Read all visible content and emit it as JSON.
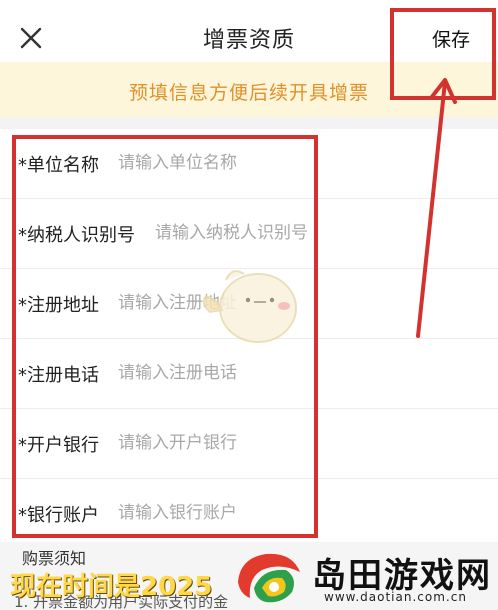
{
  "header": {
    "title": "增票资质",
    "save_label": "保存"
  },
  "notice": {
    "text": "预填信息方便后续开具增票"
  },
  "form": {
    "fields": [
      {
        "label": "*单位名称",
        "placeholder": "请输入单位名称",
        "value": ""
      },
      {
        "label": "*纳税人识别号",
        "placeholder": "请输入纳税人识别号",
        "value": ""
      },
      {
        "label": "*注册地址",
        "placeholder": "请输入注册地址",
        "value": ""
      },
      {
        "label": "*注册电话",
        "placeholder": "请输入注册电话",
        "value": ""
      },
      {
        "label": "*开户银行",
        "placeholder": "请输入开户银行",
        "value": ""
      },
      {
        "label": "*银行账户",
        "placeholder": "请输入银行账户",
        "value": ""
      }
    ]
  },
  "footer": {
    "title": "购票须知",
    "line1": "1. 开票金额为用户实际支付的金"
  },
  "overlay": {
    "text": "现在时间是2025"
  },
  "watermark": {
    "name": "岛田游戏网",
    "url": "www.daotian.com.cn"
  },
  "colors": {
    "notice_bg": "#fdf6db",
    "notice_text": "#e0912a",
    "highlight": "#d2332f"
  }
}
